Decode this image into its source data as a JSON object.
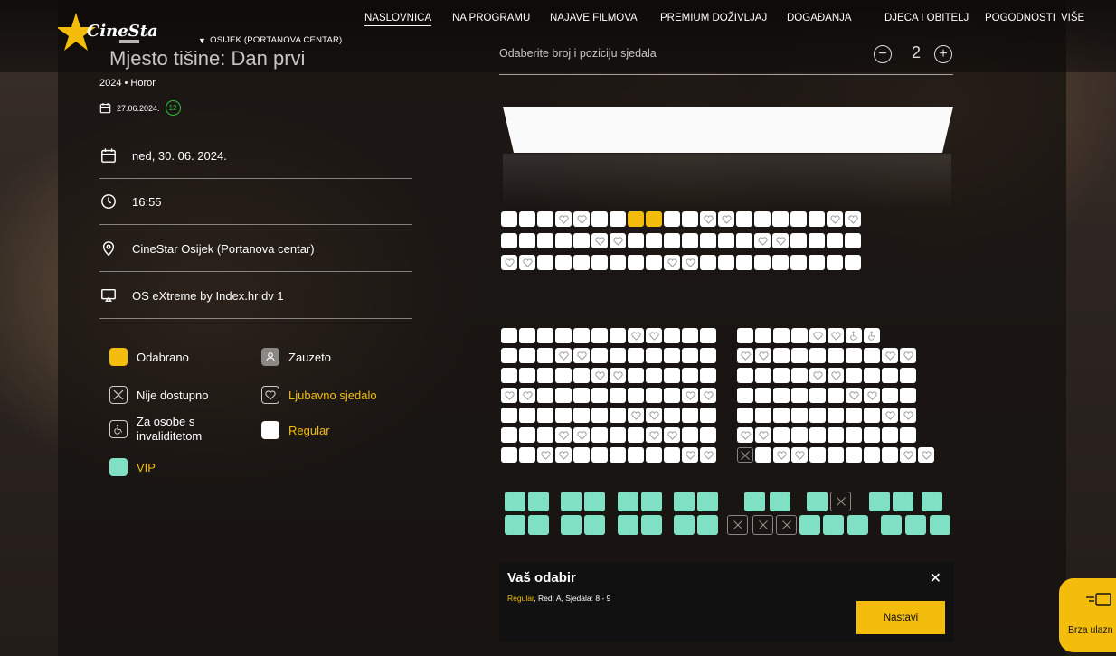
{
  "nav": {
    "items": [
      {
        "label": "NASLOVNICA",
        "active": true
      },
      {
        "label": "NA PROGRAMU",
        "active": false
      },
      {
        "label": "NAJAVE FILMOVA",
        "active": false
      },
      {
        "label": "PREMIUM DOŽIVLJAJ",
        "active": false
      },
      {
        "label": "DOGAĐANJA",
        "active": false
      },
      {
        "label": "DJECA I OBITELJ",
        "active": false
      },
      {
        "label": "POGODNOSTI",
        "active": false
      },
      {
        "label": "VIŠE",
        "active": false
      }
    ]
  },
  "brand": {
    "logo_text": "CineStar"
  },
  "location": {
    "label": "OSIJEK (PORTANOVA CENTAR)"
  },
  "movie": {
    "title": "Mjesto tišine: Dan prvi",
    "year_genre": "2024 • Horor",
    "release_date": "27.06.2024.",
    "age_rating": "12"
  },
  "details": {
    "date": "ned, 30. 06. 2024.",
    "time": "16:55",
    "cinema": "CineStar Osijek (Portanova centar)",
    "hall": "OS eXtreme by Index.hr dv 1"
  },
  "legend": {
    "selected": "Odabrano",
    "taken": "Zauzeto",
    "unavailable": "Nije dostupno",
    "love_seat": "Ljubavno sjedalo",
    "disabled_line1": "Za osobe s",
    "disabled_line2": "invaliditetom",
    "regular": "Regular",
    "vip": "VIP"
  },
  "picker": {
    "label": "Odaberite broj i poziciju sjedala",
    "count": "2"
  },
  "selection": {
    "title": "Vaš odabir",
    "type": "Regular",
    "detail": ", Red: A, Sjedala: 8 - 9",
    "button": "Nastavi"
  },
  "fast_entry": {
    "label": "Brza ulazn"
  },
  "colors": {
    "accent": "#f4bd0b",
    "vip": "#7fe0c3",
    "age_badge": "#2bbf3c",
    "regular": "#ffffff"
  },
  "seat_map": {
    "top_block": [
      "RRRLLRRSSRRLLRRRRRLL",
      "RRRRRLLRRRRRRRLLRRRR",
      "LLRRRRRRRLLRRRRRRRRR"
    ],
    "lower_left": [
      "RRRRRRRLLRRR",
      "RRRLLRRRRRRR",
      "RRRRRLLRRRRR",
      "LLRRRRRRRRLL",
      "RRRRRRRLLRRR",
      "RRRLLRRRLLRR",
      "RRLLRRRRRRLL"
    ],
    "lower_right": [
      "RRRRLLDD..",
      "LLRRRRRRLL",
      "RRRRLLRRRR",
      "RRRRRRLLRR",
      "RRRRRRRRLL",
      "LLRRRRRRRR",
      "XRLLRRRRRLL"
    ],
    "vip_row_1": "VVVVVVVVVVVXVVVVV",
    "vip_row_2": "VVVVVVVVXXXVVVVVVVVV"
  }
}
